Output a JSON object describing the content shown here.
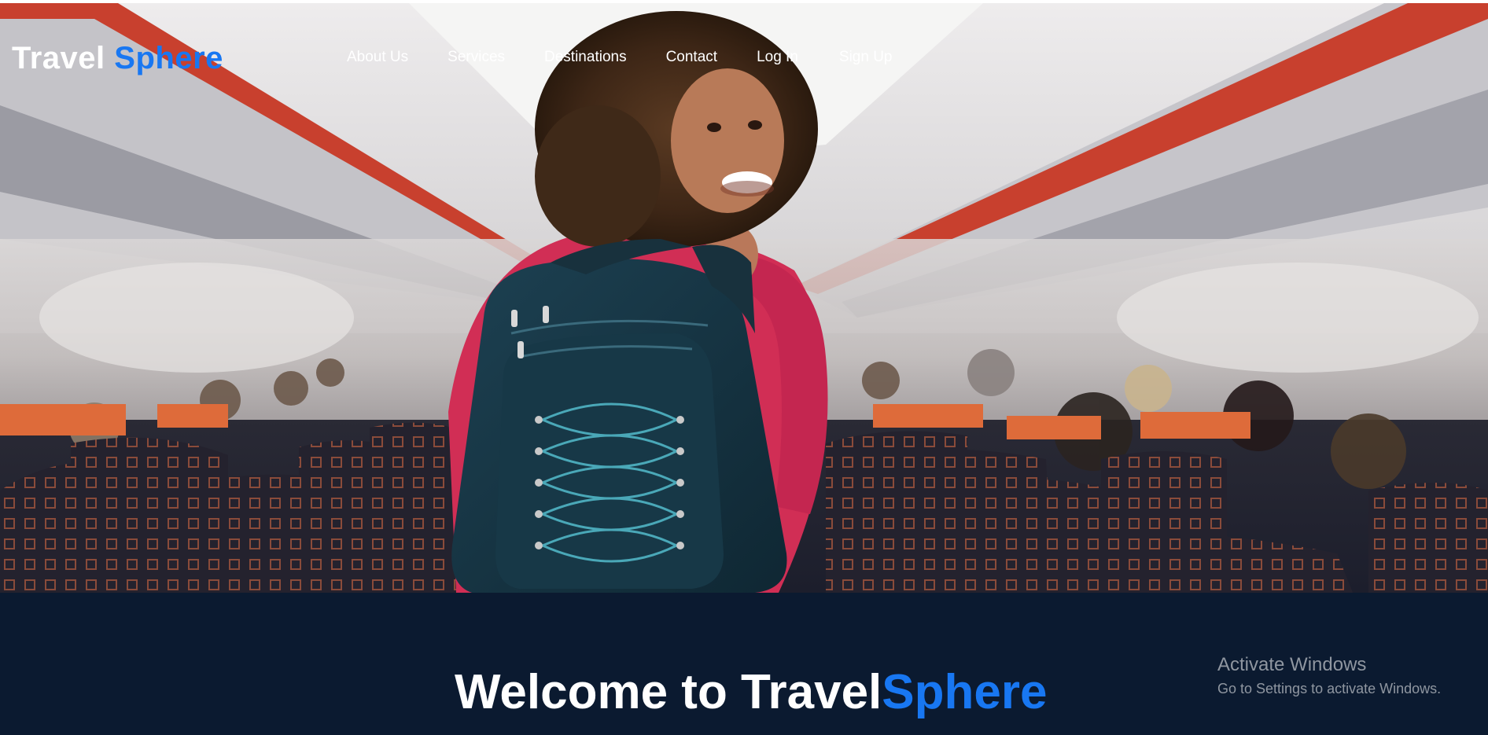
{
  "brand": {
    "logo_primary": "Travel",
    "logo_accent": "Sphere",
    "accent_color": "#1877f2"
  },
  "nav": {
    "items": [
      {
        "label": "About Us"
      },
      {
        "label": "Services"
      },
      {
        "label": "Destinations"
      },
      {
        "label": "Contact"
      },
      {
        "label": "Log In"
      },
      {
        "label": "Sign Up"
      }
    ]
  },
  "hero": {
    "image": "smiling-traveler-with-backpack-in-airplane-aisle"
  },
  "welcome": {
    "prefix": "Welcome to Travel",
    "accent": "Sphere"
  },
  "watermark": {
    "title": "Activate Windows",
    "subtitle": "Go to Settings to activate Windows."
  },
  "colors": {
    "lower_section_bg": "#0b1a30",
    "text_white": "#ffffff"
  }
}
